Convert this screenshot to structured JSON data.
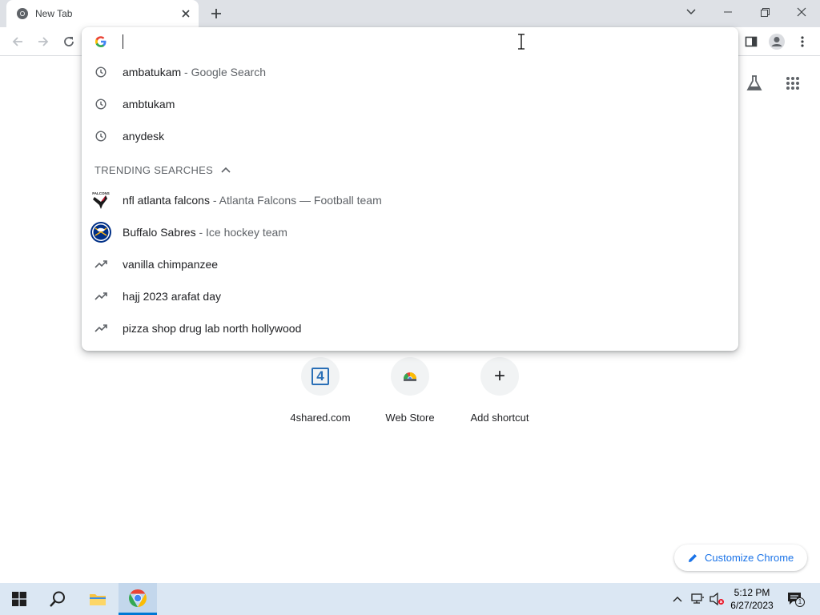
{
  "browser": {
    "tab_title": "New Tab",
    "new_tab_symbol": "+",
    "close_symbol": "✕"
  },
  "omnibox": {
    "value": "",
    "suggestions": [
      {
        "text": "ambatukam",
        "desc": " - Google Search",
        "icon": "history-icon"
      },
      {
        "text": "ambtukam",
        "desc": "",
        "icon": "history-icon"
      },
      {
        "text": "anydesk",
        "desc": "",
        "icon": "history-icon"
      }
    ],
    "trending_header": "TRENDING SEARCHES",
    "trending": [
      {
        "text": "nfl atlanta falcons",
        "desc": " - Atlanta Falcons — Football team",
        "icon": "falcons-logo-icon",
        "logo_text": "FALCONS"
      },
      {
        "text": "Buffalo Sabres",
        "desc": " - Ice hockey team",
        "icon": "sabres-logo-icon"
      },
      {
        "text": "vanilla chimpanzee",
        "desc": "",
        "icon": "trending-icon"
      },
      {
        "text": "hajj 2023 arafat day",
        "desc": "",
        "icon": "trending-icon"
      },
      {
        "text": "pizza shop drug lab north hollywood",
        "desc": "",
        "icon": "trending-icon"
      }
    ]
  },
  "ntp": {
    "shortcuts": [
      {
        "label": "4shared.com",
        "icon": "4shared-icon",
        "glyph": "4"
      },
      {
        "label": "Web Store",
        "icon": "web-store-icon"
      },
      {
        "label": "Add shortcut",
        "icon": "plus-icon",
        "glyph": "+"
      }
    ],
    "customize_label": "Customize Chrome"
  },
  "taskbar": {
    "time": "5:12 PM",
    "date": "6/27/2023",
    "notification_count": "1"
  },
  "colors": {
    "accent": "#1a73e8",
    "tabstrip": "#dee1e6",
    "taskbar": "#dbe7f3"
  }
}
